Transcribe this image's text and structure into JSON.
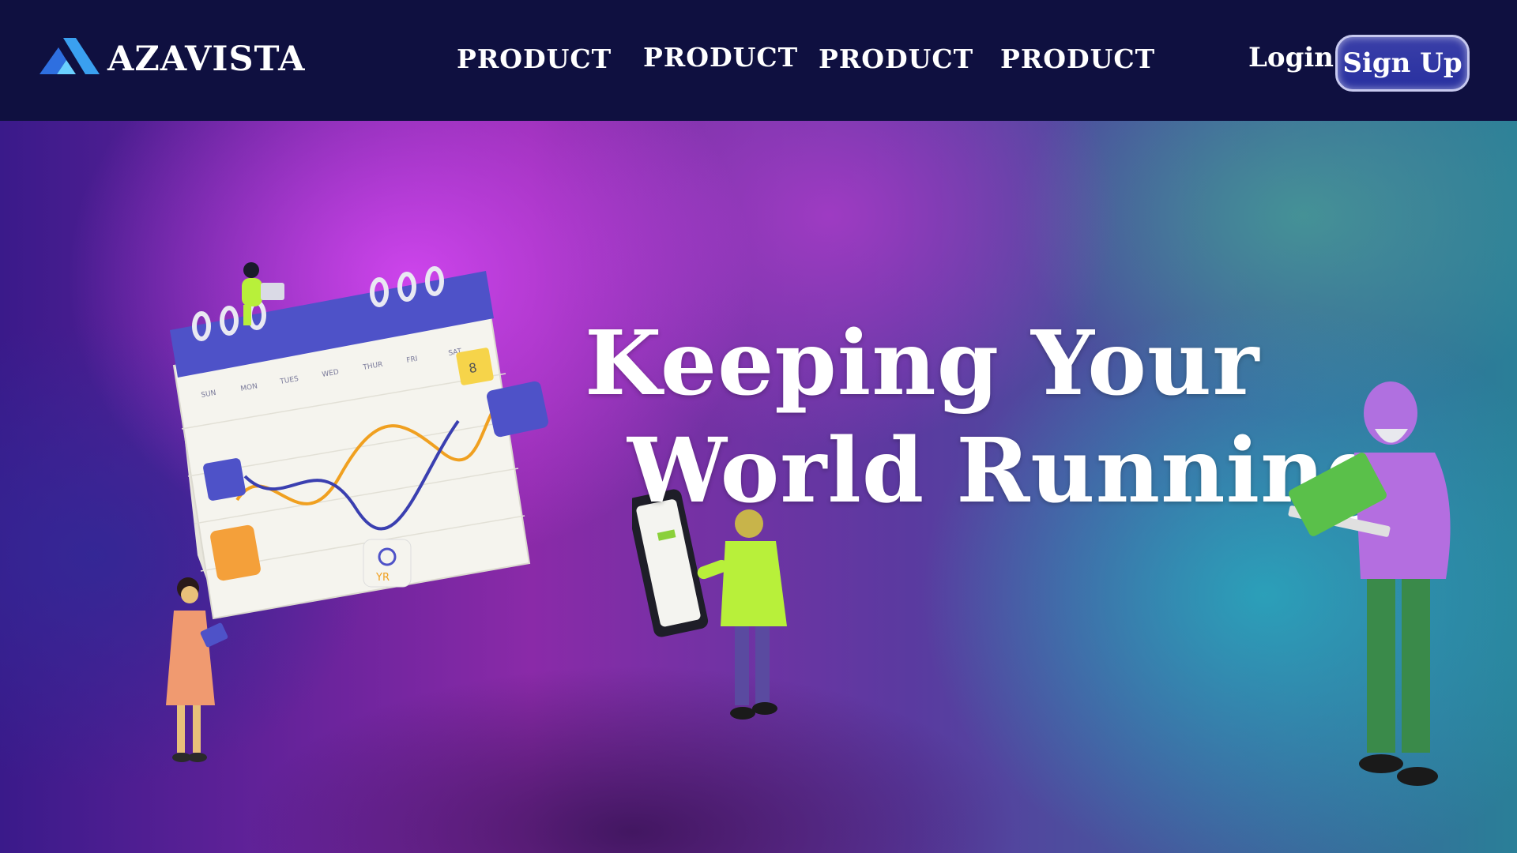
{
  "brand": {
    "name": "AZAVISTA",
    "logo_icon": "triangle-logo-icon"
  },
  "nav": {
    "links": [
      "PRODUCT",
      "PRODUCT",
      "PRODUCT",
      "PRODUCT"
    ],
    "login_label": "Login",
    "signup_label": "Sign Up"
  },
  "hero": {
    "title_line1": "Keeping Your",
    "title_line2": "World Running"
  },
  "calendar": {
    "weekdays": [
      "SUN",
      "MON",
      "TUES",
      "WED",
      "THUR",
      "FRI",
      "SAT"
    ],
    "badge_number": "8",
    "note_text": "YR"
  },
  "colors": {
    "nav_bg": "#0f1040",
    "accent": "#3a3fa8",
    "calendar_header": "#4e52c8"
  }
}
